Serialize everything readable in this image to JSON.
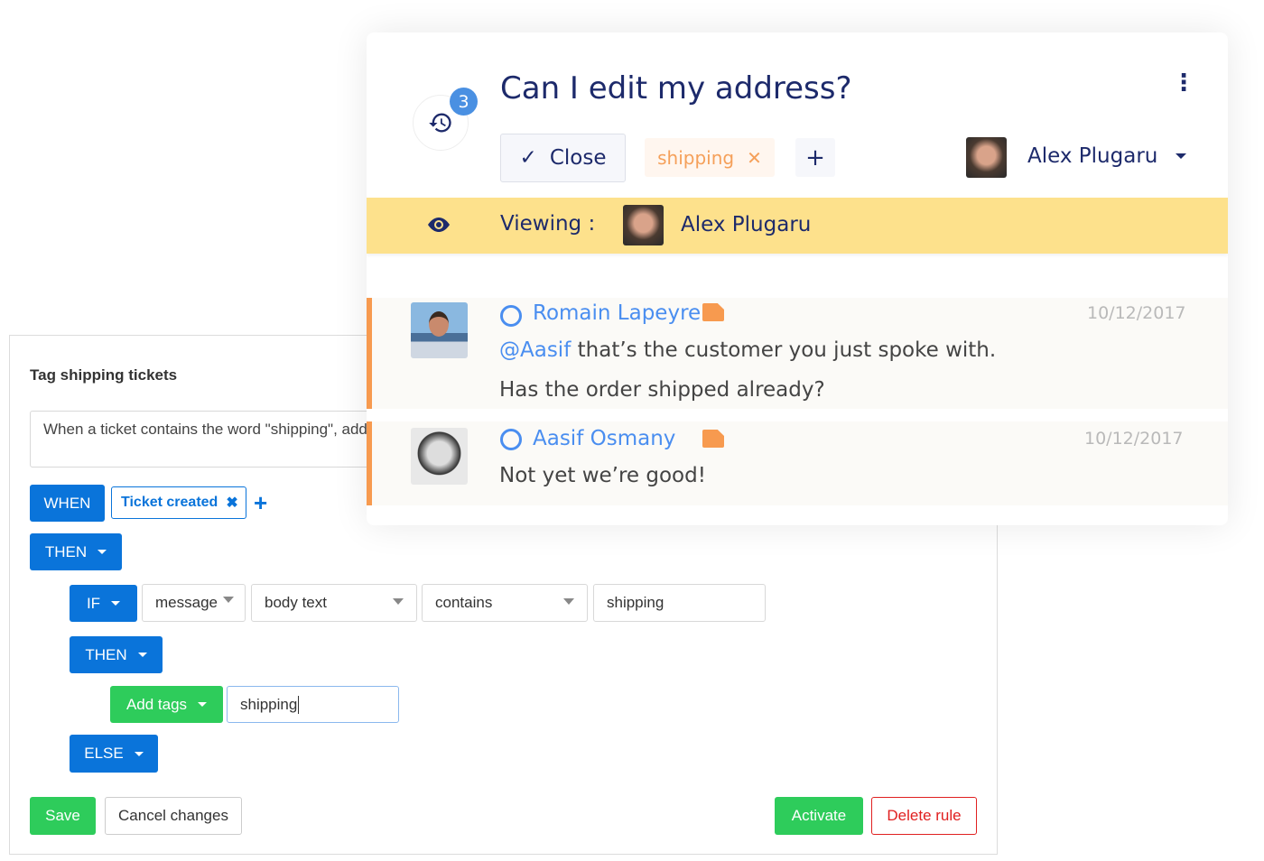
{
  "rule": {
    "title": "Tag shipping tickets",
    "description": "When a ticket contains the word \"shipping\", add the tag",
    "when_label": "WHEN",
    "trigger": "Ticket created",
    "then_label": "THEN",
    "if_label": "IF",
    "if_field": "message",
    "if_subfield": "body text",
    "if_operator": "contains",
    "if_value": "shipping",
    "inner_then_label": "THEN",
    "action_label": "Add tags",
    "action_value": "shipping",
    "else_label": "ELSE",
    "save": "Save",
    "cancel": "Cancel changes",
    "activate": "Activate",
    "delete": "Delete rule"
  },
  "ticket": {
    "title": "Can I edit my address?",
    "history_count": "3",
    "close_label": "Close",
    "tag": "shipping",
    "assignee": "Alex Plugaru",
    "viewing_label": "Viewing :",
    "viewer": "Alex Plugaru",
    "messages": [
      {
        "author": "Romain Lapeyre",
        "date": "10/12/2017",
        "mention": "@Aasif",
        "line1": " that’s the customer you just spoke with.",
        "line2": "Has the order shipped already?"
      },
      {
        "author": "Aasif Osmany",
        "date": "10/12/2017",
        "line1": "Not yet we’re good!"
      }
    ]
  },
  "colors": {
    "primary": "#0a74da",
    "success": "#2ecc5b",
    "danger": "#e02020",
    "navy": "#1d2a6b",
    "viewing_bar": "#fde18c",
    "note_accent": "#f79a4f",
    "author_link": "#4a8ef0"
  }
}
